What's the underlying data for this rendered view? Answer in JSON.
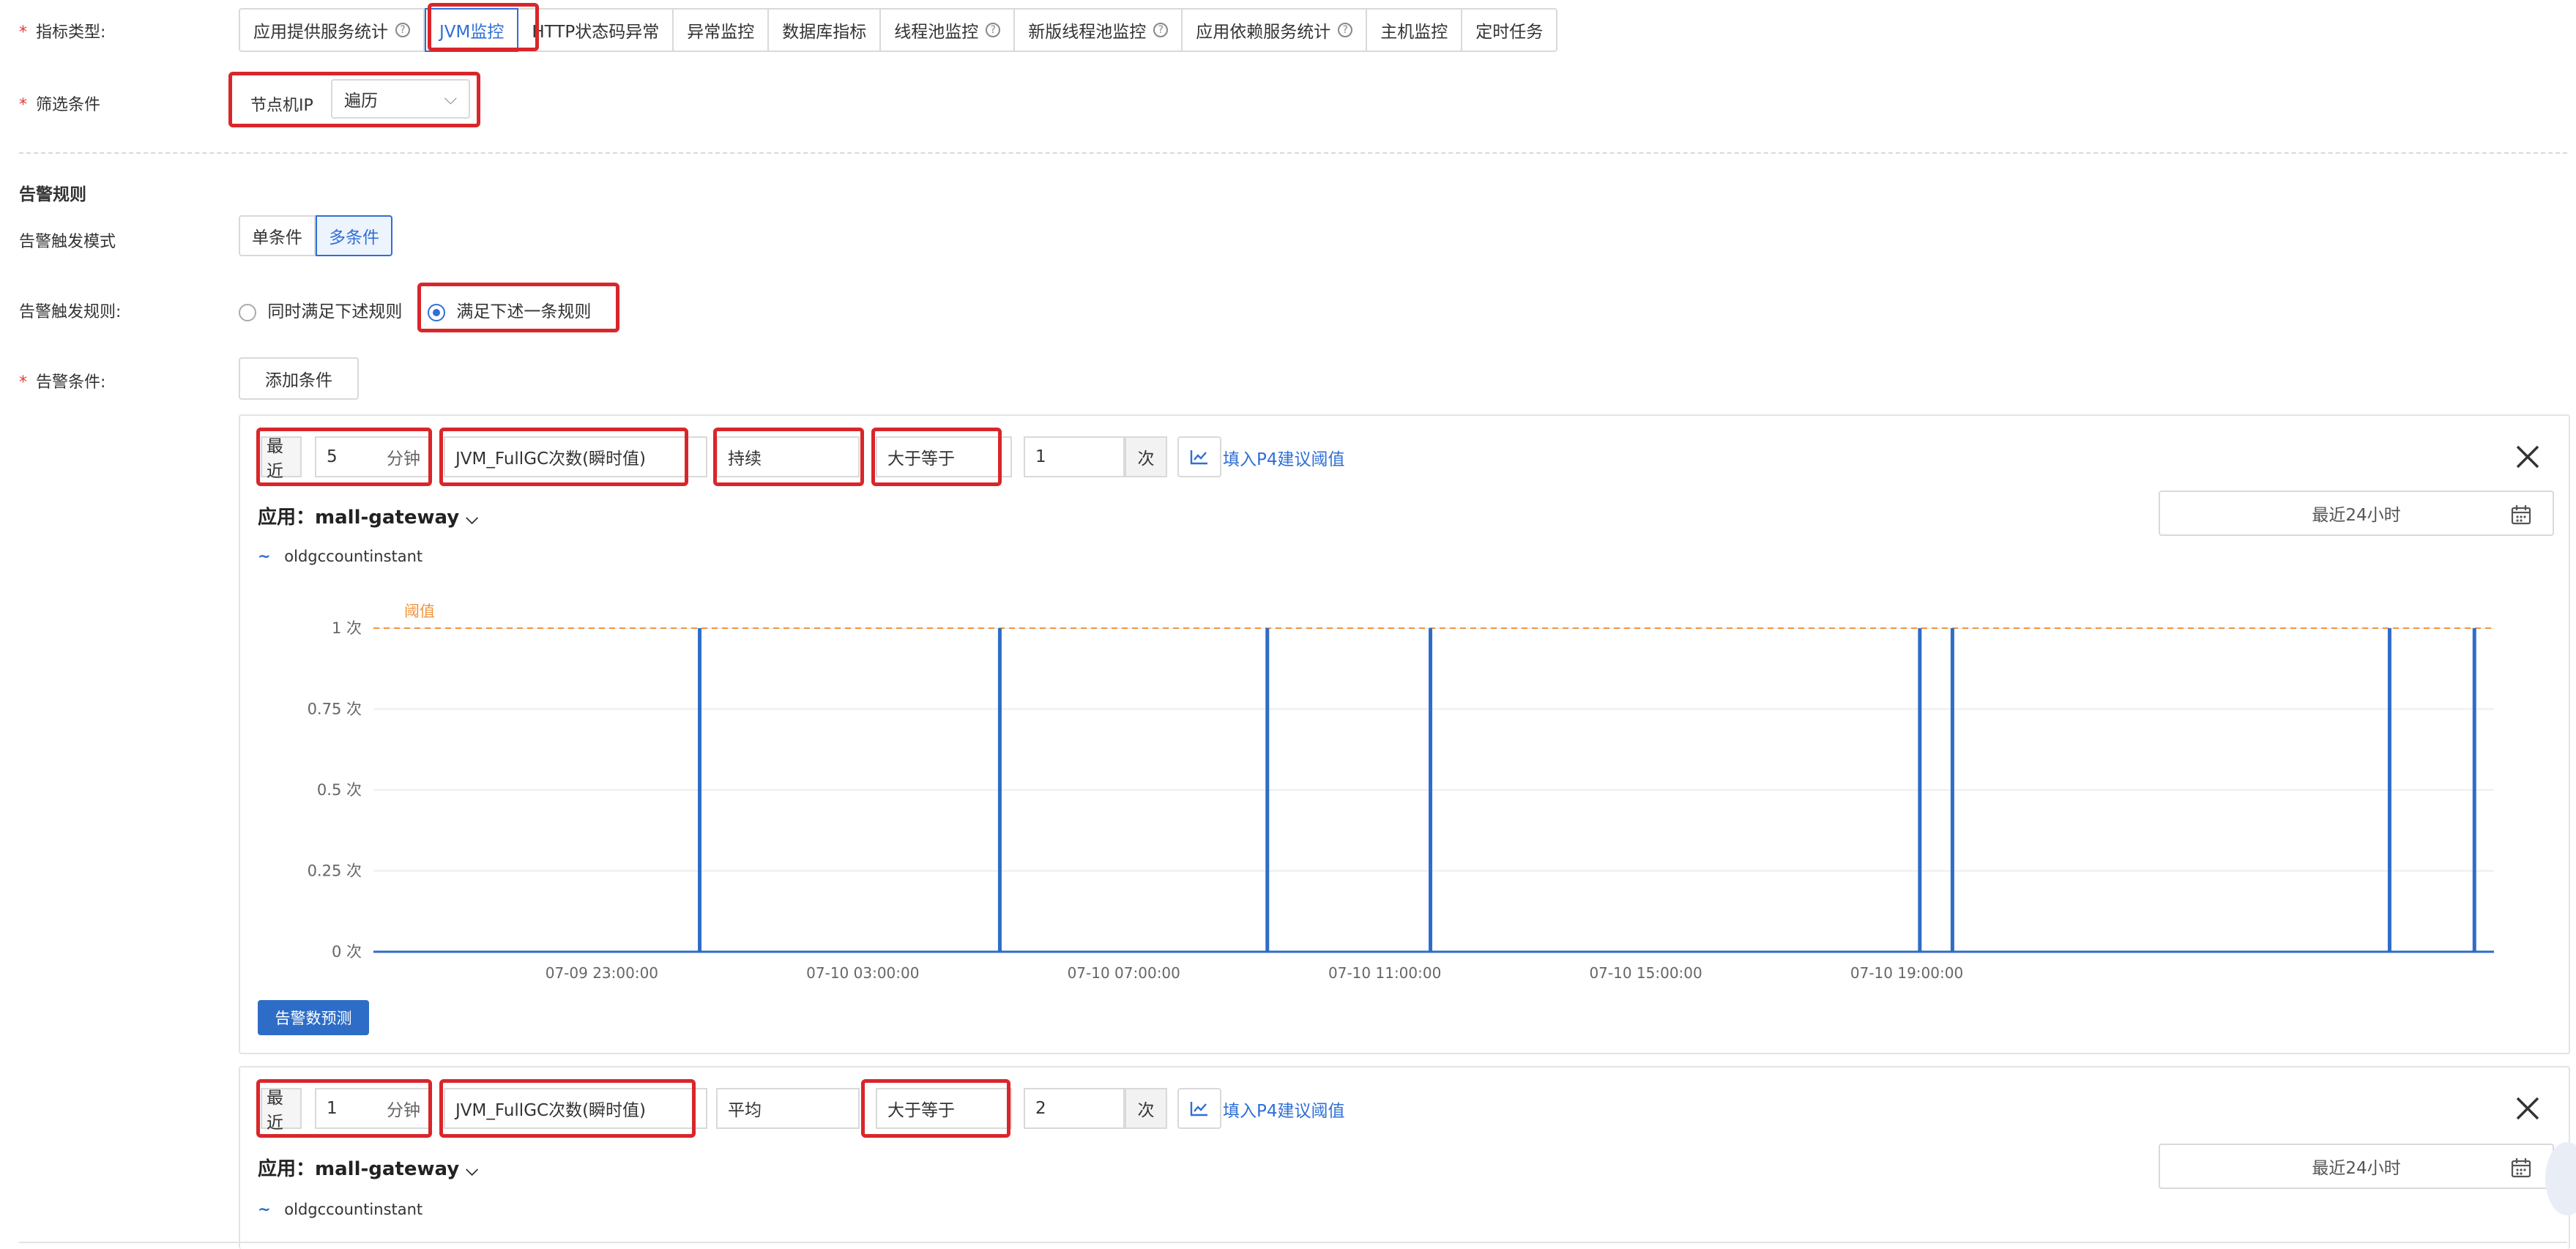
{
  "metric_type": {
    "label": "指标类型:",
    "tabs": [
      "应用提供服务统计",
      "JVM监控",
      "HTTP状态码异常",
      "异常监控",
      "数据库指标",
      "线程池监控",
      "新版线程池监控",
      "应用依赖服务统计",
      "主机监控",
      "定时任务"
    ],
    "active": "JVM监控"
  },
  "filter": {
    "label": "筛选条件",
    "field_label": "节点机IP",
    "select_value": "遍历"
  },
  "rules": {
    "section_title": "告警规则",
    "mode_label": "告警触发模式",
    "mode_options": [
      "单条件",
      "多条件"
    ],
    "mode_active": "多条件",
    "trigger_label": "告警触发规则:",
    "trigger_options": [
      "同时满足下述规则",
      "满足下述一条规则"
    ],
    "trigger_selected": "满足下述一条规则",
    "condition_label": "告警条件:",
    "add_button": "添加条件"
  },
  "conditions": [
    {
      "recent_label": "最近",
      "recent_value": "5",
      "unit": "分钟",
      "metric": "JVM_FullGC次数(瞬时值)",
      "agg": "持续",
      "operator": "大于等于",
      "threshold": "1",
      "count_unit": "次",
      "suggest_link": "填入P4建议阈值",
      "app_label": "应用：",
      "app_name": "mall-gateway",
      "time_range": "最近24小时",
      "legend": "oldgccountinstant",
      "predict_button": "告警数预测"
    },
    {
      "recent_label": "最近",
      "recent_value": "1",
      "unit": "分钟",
      "metric": "JVM_FullGC次数(瞬时值)",
      "agg": "平均",
      "operator": "大于等于",
      "threshold": "2",
      "count_unit": "次",
      "suggest_link": "填入P4建议阈值",
      "app_label": "应用：",
      "app_name": "mall-gateway",
      "time_range": "最近24小时",
      "legend": "oldgccountinstant"
    }
  ],
  "chart_data": {
    "type": "line",
    "series": [
      {
        "name": "oldgccountinstant",
        "spikes_at_hours": [
          1.5,
          6.1,
          10.2,
          12.7,
          20.2,
          20.7,
          27.4,
          28.7
        ],
        "spike_value": 1,
        "base_value": 0
      }
    ],
    "x_range_hours_from_first_tick_minus": [
      -3.5,
      29.0
    ],
    "x_ticks": [
      "07-09 23:00:00",
      "07-10 03:00:00",
      "07-10 07:00:00",
      "07-10 11:00:00",
      "07-10 15:00:00",
      "07-10 19:00:00"
    ],
    "y_ticks": [
      "0 次",
      "0.25 次",
      "0.5 次",
      "0.75 次",
      "1 次"
    ],
    "ylim": [
      0,
      1
    ],
    "threshold": {
      "label": "阈值",
      "value": 1
    },
    "colors": {
      "line": "#2e6dc7",
      "threshold": "#f0953f"
    },
    "grid": true
  }
}
